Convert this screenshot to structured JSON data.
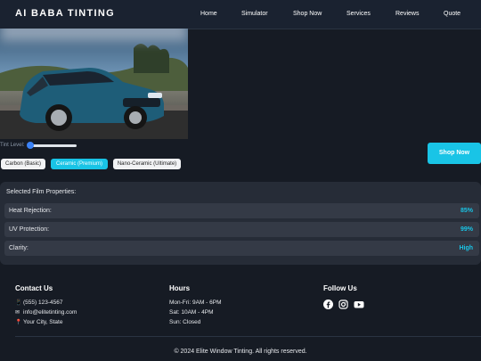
{
  "brand": "AI BABA TINTING",
  "nav": [
    "Home",
    "Simulator",
    "Shop Now",
    "Services",
    "Reviews",
    "Quote"
  ],
  "tint": {
    "label": "Tint Level:",
    "level": 0
  },
  "films": [
    "Carbon (Basic)",
    "Ceramic (Premium)",
    "Nano-Ceramic (Ultimate)"
  ],
  "selected_film": "Ceramic (Premium)",
  "shop_button": "Shop Now",
  "properties": {
    "title": "Selected Film Properties:",
    "rows": [
      {
        "label": "Heat Rejection:",
        "value": "85%"
      },
      {
        "label": "UV Protection:",
        "value": "99%"
      },
      {
        "label": "Clarity:",
        "value": "High"
      }
    ]
  },
  "footer": {
    "contact": {
      "title": "Contact Us",
      "phone": "(555) 123-4567",
      "email": "info@elitetinting.com",
      "address": "Your City, State"
    },
    "hours": {
      "title": "Hours",
      "lines": [
        "Mon-Fri: 9AM - 6PM",
        "Sat: 10AM - 4PM",
        "Sun: Closed"
      ]
    },
    "follow": {
      "title": "Follow Us",
      "icons": [
        "facebook-icon",
        "instagram-icon",
        "youtube-icon"
      ]
    },
    "copyright": "© 2024 Elite Window Tinting. All rights reserved."
  },
  "colors": {
    "accent": "#19c4e6",
    "background": "#161b24",
    "header": "#1a2230",
    "panel": "#262c37"
  }
}
